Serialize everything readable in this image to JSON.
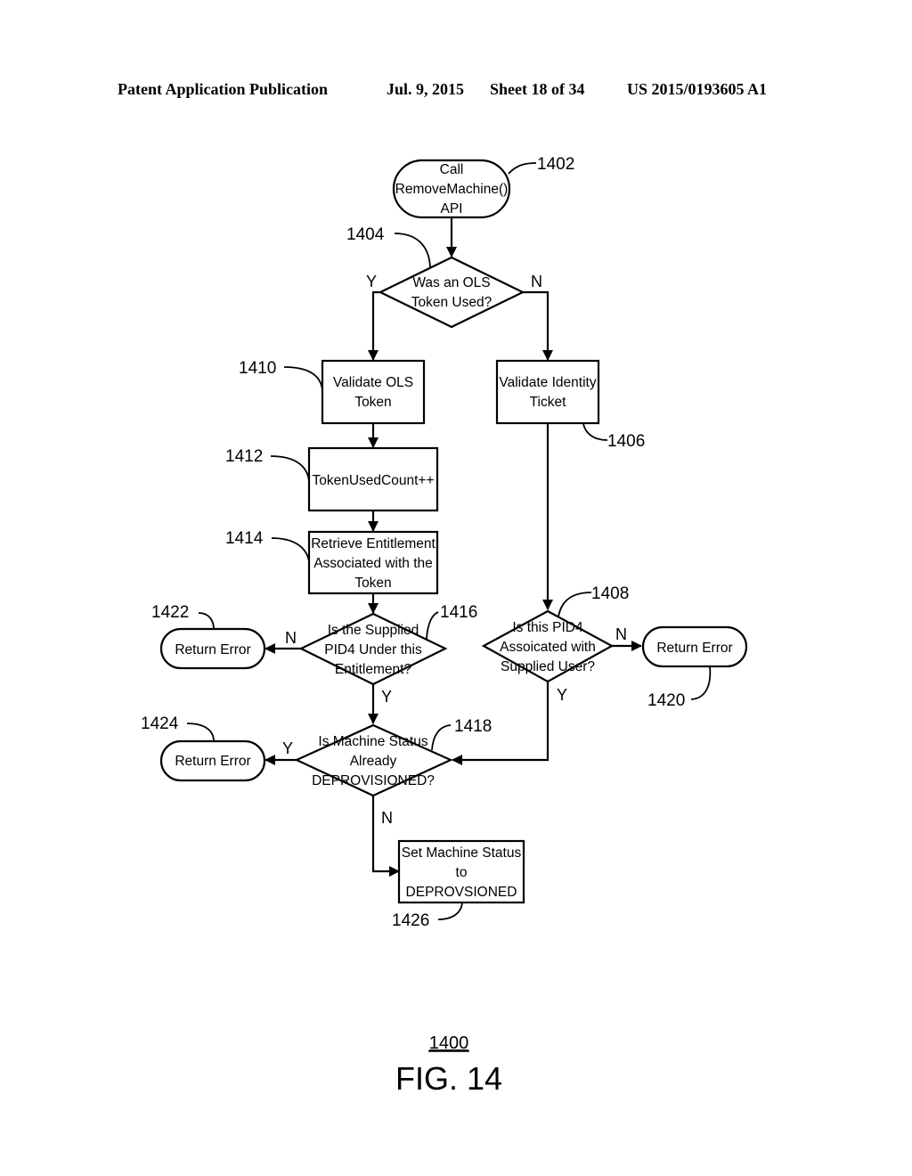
{
  "header": {
    "publication": "Patent Application Publication",
    "date": "Jul. 9, 2015",
    "sheet": "Sheet 18 of 34",
    "number": "US 2015/0193605 A1"
  },
  "figure": {
    "ref": "1400",
    "title": "FIG. 14"
  },
  "nodes": {
    "n1402": {
      "ref": "1402",
      "type": "terminal",
      "lines": [
        "Call",
        "RemoveMachine()",
        "API"
      ]
    },
    "n1404": {
      "ref": "1404",
      "type": "decision",
      "lines": [
        "Was an OLS",
        "Token Used?"
      ]
    },
    "n1410": {
      "ref": "1410",
      "type": "process",
      "lines": [
        "Validate OLS",
        "Token"
      ]
    },
    "n1406": {
      "ref": "1406",
      "type": "process",
      "lines": [
        "Validate Identity",
        "Ticket"
      ]
    },
    "n1412": {
      "ref": "1412",
      "type": "process",
      "lines": [
        "TokenUsedCount++"
      ]
    },
    "n1414": {
      "ref": "1414",
      "type": "process",
      "lines": [
        "Retrieve Entitlement",
        "Associated with the",
        "Token"
      ]
    },
    "n1416": {
      "ref": "1416",
      "type": "decision",
      "lines": [
        "Is the Supplied",
        "PID4 Under this",
        "Entitlement?"
      ]
    },
    "n1408": {
      "ref": "1408",
      "type": "decision",
      "lines": [
        "Is this PID4",
        "Assoicated with",
        "Supplied User?"
      ]
    },
    "n1422": {
      "ref": "1422",
      "type": "terminal",
      "lines": [
        "Return Error"
      ]
    },
    "n1420": {
      "ref": "1420",
      "type": "terminal",
      "lines": [
        "Return Error"
      ]
    },
    "n1418": {
      "ref": "1418",
      "type": "decision",
      "lines": [
        "Is Machine Status",
        "Already",
        "DEPROVISIONED?"
      ]
    },
    "n1424": {
      "ref": "1424",
      "type": "terminal",
      "lines": [
        "Return Error"
      ]
    },
    "n1426": {
      "ref": "1426",
      "type": "process",
      "lines": [
        "Set Machine Status",
        "to",
        "DEPROVSIONED"
      ]
    }
  },
  "edges": {
    "e1404_yes": "Y",
    "e1404_no": "N",
    "e1416_no": "N",
    "e1416_yes": "Y",
    "e1408_no": "N",
    "e1408_yes": "Y",
    "e1418_yes": "Y",
    "e1418_no": "N"
  }
}
